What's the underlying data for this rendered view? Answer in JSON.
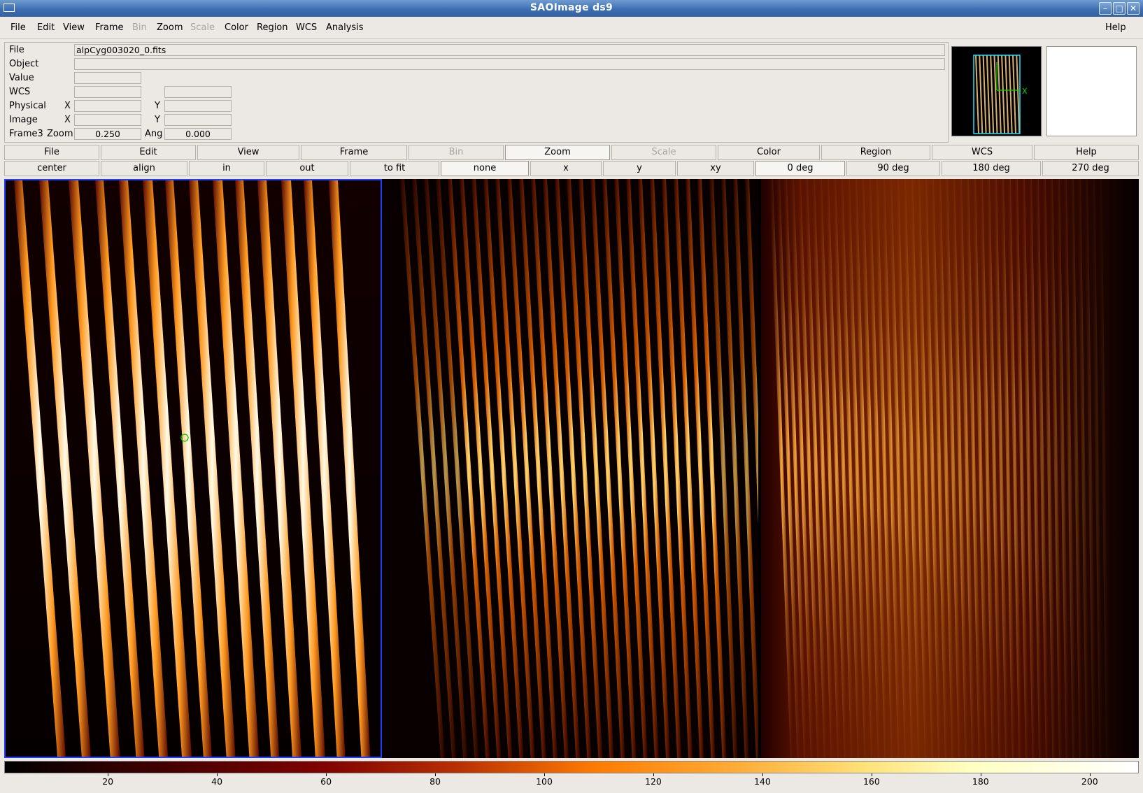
{
  "window": {
    "title": "SAOImage ds9"
  },
  "menubar": {
    "items": [
      {
        "label": "File",
        "disabled": false
      },
      {
        "label": "Edit",
        "disabled": false
      },
      {
        "label": "View",
        "disabled": false
      },
      {
        "label": "Frame",
        "disabled": false
      },
      {
        "label": "Bin",
        "disabled": true
      },
      {
        "label": "Zoom",
        "disabled": false
      },
      {
        "label": "Scale",
        "disabled": true
      },
      {
        "label": "Color",
        "disabled": false
      },
      {
        "label": "Region",
        "disabled": false
      },
      {
        "label": "WCS",
        "disabled": false
      },
      {
        "label": "Analysis",
        "disabled": false
      }
    ],
    "help": "Help"
  },
  "info": {
    "file_label": "File",
    "file_value": "alpCyg003020_0.fits",
    "object_label": "Object",
    "object_value": "",
    "value_label": "Value",
    "value_value": "",
    "wcs_label": "WCS",
    "wcs_value1": "",
    "wcs_value2": "",
    "physical_label": "Physical",
    "physical_x_label": "X",
    "physical_y_label": "Y",
    "physical_x": "",
    "physical_y": "",
    "image_label": "Image",
    "image_x_label": "X",
    "image_y_label": "Y",
    "image_x": "",
    "image_y": "",
    "frame_label": "Frame3",
    "zoom_label": "Zoom",
    "zoom_value": "0.250",
    "angle_label": "Ang",
    "angle_value": "0.000"
  },
  "panner": {
    "compass_x_label": "X"
  },
  "buttonbar_main": [
    {
      "label": "File",
      "active": false,
      "disabled": false
    },
    {
      "label": "Edit",
      "active": false,
      "disabled": false
    },
    {
      "label": "View",
      "active": false,
      "disabled": false
    },
    {
      "label": "Frame",
      "active": false,
      "disabled": false
    },
    {
      "label": "Bin",
      "active": false,
      "disabled": true
    },
    {
      "label": "Zoom",
      "active": true,
      "disabled": false
    },
    {
      "label": "Scale",
      "active": false,
      "disabled": true
    },
    {
      "label": "Color",
      "active": false,
      "disabled": false
    },
    {
      "label": "Region",
      "active": false,
      "disabled": false
    },
    {
      "label": "WCS",
      "active": false,
      "disabled": false
    },
    {
      "label": "Help",
      "active": false,
      "disabled": false
    }
  ],
  "buttonbar_zoom": [
    {
      "label": "center",
      "active": false
    },
    {
      "label": "align",
      "active": false
    },
    {
      "label": "in",
      "active": false
    },
    {
      "label": "out",
      "active": false
    },
    {
      "label": "to fit",
      "active": false
    },
    {
      "label": "none",
      "active": true
    },
    {
      "label": "x",
      "active": false
    },
    {
      "label": "y",
      "active": false
    },
    {
      "label": "xy",
      "active": false
    },
    {
      "label": "0 deg",
      "active": true
    },
    {
      "label": "90 deg",
      "active": false
    },
    {
      "label": "180 deg",
      "active": false
    },
    {
      "label": "270 deg",
      "active": false
    }
  ],
  "colorbar": {
    "colormap": "heat",
    "ticks": [
      "20",
      "40",
      "60",
      "80",
      "100",
      "120",
      "140",
      "160",
      "180",
      "200"
    ]
  },
  "colors": {
    "frame_highlight": "#1f3fff",
    "marker": "#00cc00"
  }
}
